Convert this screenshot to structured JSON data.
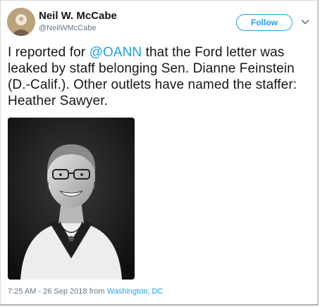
{
  "author": {
    "name": "Neil W. McCabe",
    "handle": "@NeilWMcCabe"
  },
  "actions": {
    "follow_label": "Follow"
  },
  "tweet": {
    "text_before": "I reported for ",
    "mention": "@OANN",
    "text_after": " that the Ford letter was leaked by staff belonging Sen. Dianne Feinstein (D.-Calif.). Other outlets have named the staffer: Heather Sawyer."
  },
  "meta": {
    "timestamp": "7:25 AM - 26 Sep 2018 from ",
    "location": "Washington, DC"
  },
  "colors": {
    "accent": "#1da1f2",
    "text": "#14171a",
    "muted": "#657786"
  },
  "icons": [
    "avatar",
    "chevron-down-icon"
  ]
}
